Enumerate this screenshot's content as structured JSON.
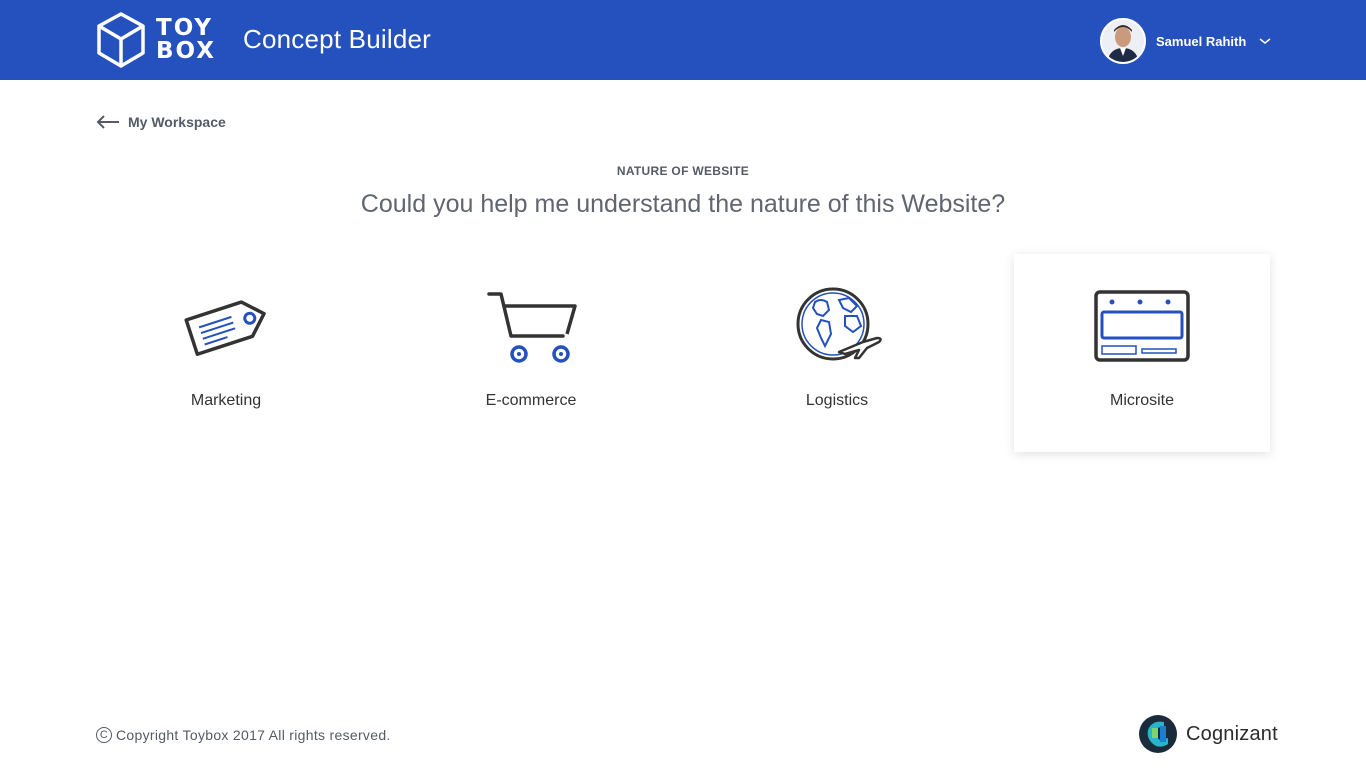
{
  "header": {
    "logo_line1": "TOY",
    "logo_line2": "BOX",
    "app_title": "Concept Builder",
    "user_name": "Samuel Rahith"
  },
  "nav": {
    "back_label": "My Workspace"
  },
  "main": {
    "eyebrow": "NATURE OF WEBSITE",
    "question": "Could you help me understand the nature of this Website?",
    "options": [
      {
        "label": "Marketing",
        "icon": "price-tag-icon",
        "selected": false
      },
      {
        "label": "E-commerce",
        "icon": "shopping-cart-icon",
        "selected": false
      },
      {
        "label": "Logistics",
        "icon": "globe-plane-icon",
        "selected": false
      },
      {
        "label": "Microsite",
        "icon": "browser-window-icon",
        "selected": true
      }
    ]
  },
  "footer": {
    "copyright": "Copyright Toybox 2017 All rights reserved.",
    "partner": "Cognizant"
  },
  "colors": {
    "header_bg": "#2451bd",
    "accent": "#2451bd",
    "icon_stroke": "#333333"
  }
}
